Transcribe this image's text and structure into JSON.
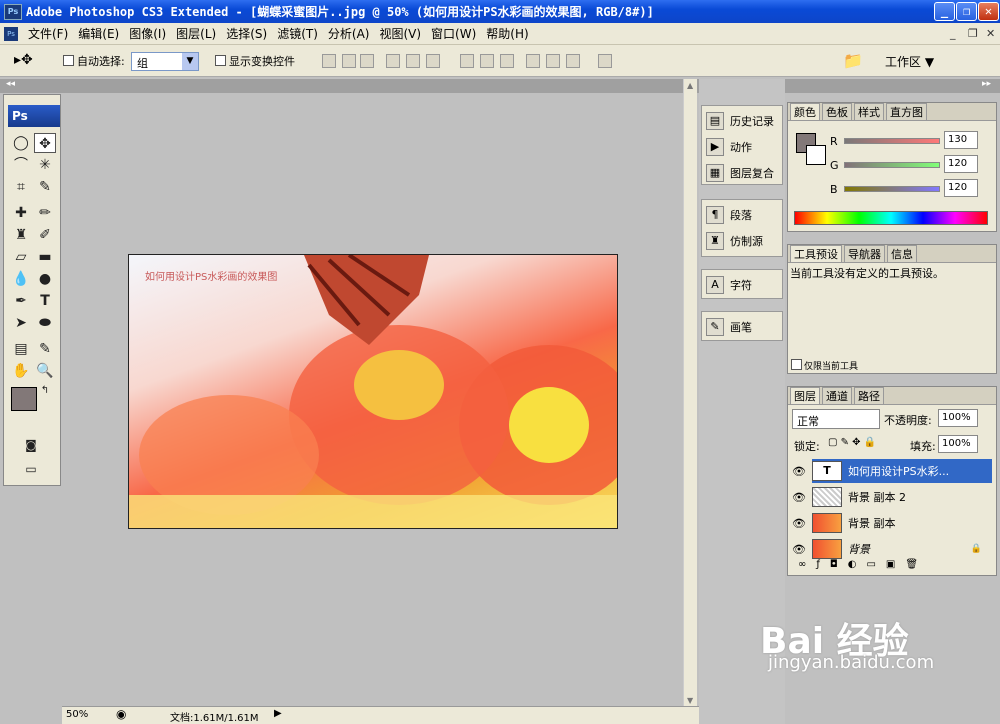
{
  "window": {
    "title": "Adobe Photoshop CS3 Extended - [蝴蝶采蜜图片..jpg @ 50% (如何用设计PS水彩画的效果图, RGB/8#)]",
    "logo": "Ps"
  },
  "menu": {
    "items": [
      "文件(F)",
      "编辑(E)",
      "图像(I)",
      "图层(L)",
      "选择(S)",
      "滤镜(T)",
      "分析(A)",
      "视图(V)",
      "窗口(W)",
      "帮助(H)"
    ]
  },
  "options": {
    "auto_select_label": "自动选择:",
    "group_value": "组",
    "show_transform_label": "显示变换控件",
    "workspace_label": "工作区 ▼"
  },
  "toolbox": {
    "logo": "Ps"
  },
  "canvas": {
    "caption": "如何用设计PS水彩画的效果图"
  },
  "status": {
    "zoom": "50%",
    "doc": "文档:1.61M/1.61M"
  },
  "dock": {
    "items": [
      "历史记录",
      "动作",
      "图层复合",
      "段落",
      "仿制源",
      "字符",
      "画笔"
    ]
  },
  "color_panel": {
    "tabs": [
      "颜色",
      "色板",
      "样式",
      "直方图"
    ],
    "channels": [
      {
        "label": "R",
        "value": "130"
      },
      {
        "label": "G",
        "value": "120"
      },
      {
        "label": "B",
        "value": "120"
      }
    ],
    "fg_color": "#827878"
  },
  "tool_presets": {
    "tabs": [
      "工具预设",
      "导航器",
      "信息"
    ],
    "message": "当前工具没有定义的工具预设。",
    "only_current": "仅限当前工具"
  },
  "layers_panel": {
    "tabs": [
      "图层",
      "通道",
      "路径"
    ],
    "blend_mode": "正常",
    "opacity_label": "不透明度:",
    "opacity": "100%",
    "lock_label": "锁定:",
    "fill_label": "填充:",
    "fill": "100%",
    "layers": [
      {
        "name": "如何用设计PS水彩...",
        "type": "text"
      },
      {
        "name": "背景 副本 2",
        "type": "pattern"
      },
      {
        "name": "背景 副本",
        "type": "image"
      },
      {
        "name": "背景",
        "type": "image"
      }
    ]
  },
  "watermark": {
    "brand": "Bai 经验",
    "url": "jingyan.baidu.com"
  }
}
